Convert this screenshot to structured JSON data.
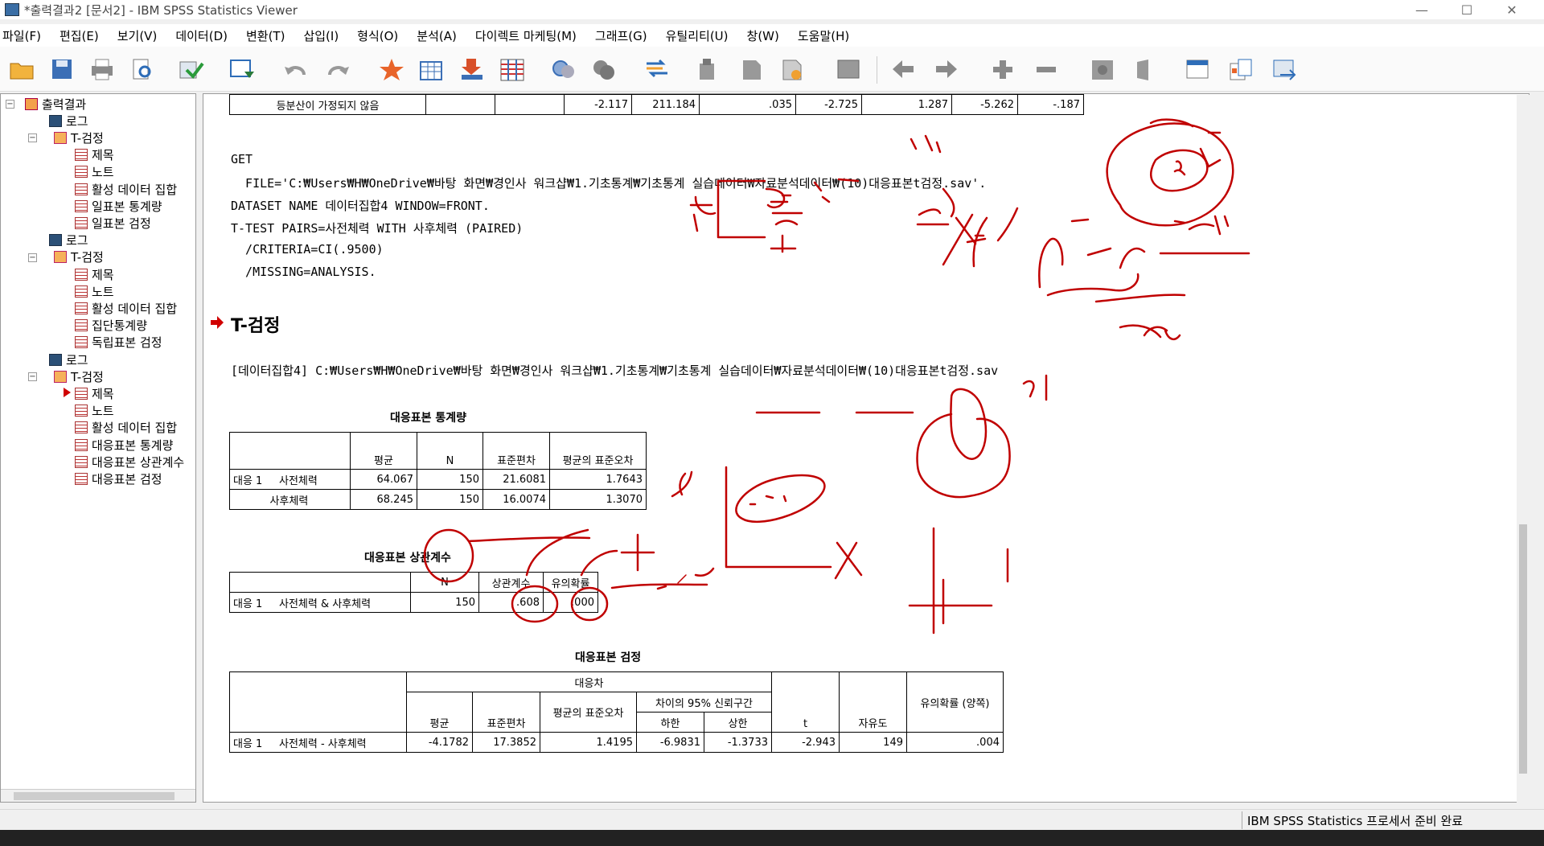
{
  "window": {
    "title": "*출력결과2 [문서2] - IBM SPSS Statistics Viewer"
  },
  "menu": [
    "파일(F)",
    "편집(E)",
    "보기(V)",
    "데이터(D)",
    "변환(T)",
    "삽입(I)",
    "형식(O)",
    "분석(A)",
    "다이렉트 마케팅(M)",
    "그래프(G)",
    "유틸리티(U)",
    "창(W)",
    "도움말(H)"
  ],
  "toolbar_icons": [
    "open-icon",
    "save-icon",
    "print-icon",
    "print-preview-icon",
    "export-icon",
    "recall-dialog-icon",
    "undo-icon",
    "redo-icon",
    "goto-data-icon",
    "goto-case-icon",
    "goto-variable-icon",
    "variables-icon",
    "designate-window-icon",
    "select-cases-icon",
    "weight-cases-icon",
    "split-file-icon",
    "value-labels-icon",
    "script-icon",
    "demote-icon",
    "promote-icon",
    "expand-icon",
    "collapse-icon",
    "show-icon",
    "hide-icon",
    "insert-heading-icon",
    "insert-title-icon",
    "insert-text-icon"
  ],
  "tree": {
    "items": [
      {
        "label": "출력결과",
        "level": 0
      },
      {
        "label": "로그",
        "level": 2
      },
      {
        "label": "T-검정",
        "level": 1
      },
      {
        "label": "제목",
        "level": 3
      },
      {
        "label": "노트",
        "level": 3
      },
      {
        "label": "활성 데이터 집합",
        "level": 3
      },
      {
        "label": "일표본 통계량",
        "level": 3
      },
      {
        "label": "일표본 검정",
        "level": 3
      },
      {
        "label": "로그",
        "level": 2
      },
      {
        "label": "T-검정",
        "level": 1
      },
      {
        "label": "제목",
        "level": 3
      },
      {
        "label": "노트",
        "level": 3
      },
      {
        "label": "활성 데이터 집합",
        "level": 3
      },
      {
        "label": "집단통계량",
        "level": 3
      },
      {
        "label": "독립표본 검정",
        "level": 3
      },
      {
        "label": "로그",
        "level": 2
      },
      {
        "label": "T-검정",
        "level": 1
      },
      {
        "label": "제목",
        "level": 3
      },
      {
        "label": "노트",
        "level": 3
      },
      {
        "label": "활성 데이터 집합",
        "level": 3
      },
      {
        "label": "대응표본 통계량",
        "level": 3
      },
      {
        "label": "대응표본 상관계수",
        "level": 3
      },
      {
        "label": "대응표본 검정",
        "level": 3
      }
    ]
  },
  "output": {
    "prev_row": [
      "등분산이 가정되지 않음",
      "",
      "",
      "-2.117",
      "211.184",
      ".035",
      "-2.725",
      "1.287",
      "-5.262",
      "-.187"
    ],
    "syntax": [
      "GET",
      "  FILE='C:₩Users₩H₩OneDrive₩바탕 화면₩경인사 워크샵₩1.기초통계₩기초통계 실습데이터₩자료분석데이터₩(10)대응표본t검정.sav'.",
      "DATASET NAME 데이터집합4 WINDOW=FRONT.",
      "T-TEST PAIRS=사전체력 WITH 사후체력 (PAIRED)",
      "  /CRITERIA=CI(.9500)",
      "  /MISSING=ANALYSIS."
    ],
    "heading": "T-검정",
    "dataset_line": "[데이터집합4] C:₩Users₩H₩OneDrive₩바탕 화면₩경인사 워크샵₩1.기초통계₩기초통계 실습데이터₩자료분석데이터₩(10)대응표본t검정.sav",
    "stats_table": {
      "title": "대응표본 통계량",
      "headers": [
        "평균",
        "N",
        "표준편차",
        "평균의 표준오차"
      ],
      "pair_label": "대응 1",
      "rows": [
        {
          "name": "사전체력",
          "mean": "64.067",
          "n": "150",
          "sd": "21.6081",
          "se": "1.7643"
        },
        {
          "name": "사후체력",
          "mean": "68.245",
          "n": "150",
          "sd": "16.0074",
          "se": "1.3070"
        }
      ]
    },
    "corr_table": {
      "title": "대응표본 상관계수",
      "headers": [
        "N",
        "상관계수",
        "유의확률"
      ],
      "pair_label": "대응 1",
      "row": {
        "name": "사전체력 & 사후체력",
        "n": "150",
        "corr": ".608",
        "sig": ".000"
      }
    },
    "test_table": {
      "title": "대응표본 검정",
      "group_header": "대응차",
      "ci_header": "차이의 95% 신뢰구간",
      "headers": [
        "평균",
        "표준편차",
        "평균의 표준오차",
        "하한",
        "상한",
        "t",
        "자유도",
        "유의확률 (양쪽)"
      ],
      "pair_label": "대응 1",
      "row": {
        "name": "사전체력 - 사후체력",
        "mean": "-4.1782",
        "sd": "17.3852",
        "se": "1.4195",
        "lower": "-6.9831",
        "upper": "-1.3733",
        "t": "-2.943",
        "df": "149",
        "sig": ".004"
      }
    }
  },
  "status": {
    "text": "IBM SPSS Statistics 프로세서 준비 완료"
  },
  "colors": {
    "ink": "#c00000",
    "arrow": "#d00000",
    "accent": "#f0a030"
  }
}
